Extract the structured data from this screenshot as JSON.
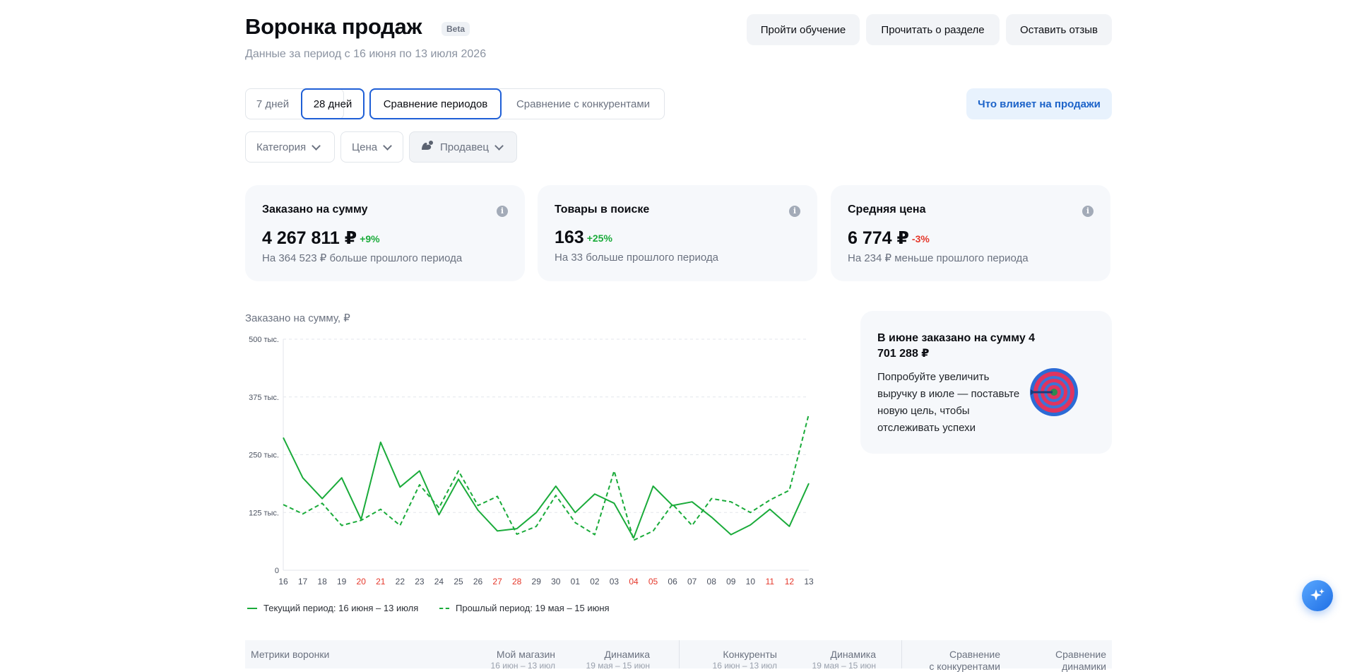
{
  "header": {
    "title": "Воронка продаж",
    "badge": "Beta",
    "period": "Данные за период с 16 июня по 13 июля 2026"
  },
  "top_buttons": {
    "training": "Пройти обучение",
    "read_about": "Прочитать о разделе",
    "feedback": "Оставить отзыв"
  },
  "periods": {
    "days7": "7 дней",
    "days28": "28 дней",
    "compare_periods": "Сравнение периодов",
    "compare_competitors": "Сравнение с конкурентами",
    "active": [
      "28 дней",
      "Сравнение периодов"
    ]
  },
  "what_affects": "Что влияет на продажи",
  "filters": {
    "category": "Категория",
    "price": "Цена",
    "seller": "Продавец"
  },
  "cards": [
    {
      "title": "Заказано на сумму",
      "value": "4 267 811 ₽",
      "change": "+9%",
      "change_color": "#1aab3a",
      "note": "На 364 523 ₽ больше прошлого периода"
    },
    {
      "title": "Товары в поиске",
      "value": "163",
      "change": "+25%",
      "change_color": "#1aab3a",
      "note": "На 33 больше прошлого периода"
    },
    {
      "title": "Средняя цена",
      "value": "6 774 ₽",
      "change": "-3%",
      "change_color": "#e5372a",
      "note": "На 234 ₽ меньше прошлого периода"
    }
  ],
  "chart": {
    "title": "Заказано на сумму, ₽",
    "legend_current": "Текущий период: 16 июня – 13 июля",
    "legend_previous": "Прошлый период: 19 мая – 15 июня"
  },
  "chart_data": {
    "type": "line",
    "ylabel": "Заказано на сумму, ₽",
    "ylim": [
      0,
      500000
    ],
    "yticks": [
      0,
      125000,
      250000,
      375000,
      500000
    ],
    "ytick_labels": [
      "0",
      "125 тыс.",
      "250 тыс.",
      "375 тыс.",
      "500 тыс."
    ],
    "categories": [
      "16",
      "17",
      "18",
      "19",
      "20",
      "21",
      "22",
      "23",
      "24",
      "25",
      "26",
      "27",
      "28",
      "29",
      "30",
      "01",
      "02",
      "03",
      "04",
      "05",
      "06",
      "07",
      "08",
      "09",
      "10",
      "11",
      "12",
      "13"
    ],
    "weekend_categories": [
      "20",
      "21",
      "27",
      "28",
      "04",
      "05",
      "11",
      "12"
    ],
    "weekend_color": "#e5372a",
    "grid": true,
    "legend_position": "bottom-left",
    "series": [
      {
        "name": "Текущий период: 16 июня – 13 июля",
        "style": "solid",
        "color": "#1aab3a",
        "values": [
          287000,
          200000,
          155000,
          200000,
          110000,
          277000,
          180000,
          215000,
          120000,
          197000,
          130000,
          85000,
          90000,
          125000,
          182000,
          125000,
          165000,
          145000,
          70000,
          182000,
          140000,
          148000,
          115000,
          77000,
          98000,
          132000,
          95000,
          188000
        ]
      },
      {
        "name": "Прошлый период: 19 мая – 15 июня",
        "style": "dashed",
        "color": "#1aab3a",
        "values": [
          142000,
          122000,
          145000,
          97000,
          108000,
          132000,
          97000,
          185000,
          135000,
          215000,
          140000,
          160000,
          78000,
          95000,
          162000,
          103000,
          77000,
          215000,
          65000,
          85000,
          143000,
          97000,
          155000,
          148000,
          125000,
          152000,
          173000,
          338000
        ]
      }
    ]
  },
  "goal_card": {
    "title": "В июне заказано на сумму 4 701 288 ₽",
    "text": "Попробуйте увеличить выручку в июле — поставьте новую цель, чтобы отслеживать успехи"
  },
  "table": {
    "metrics": "Метрики воронки",
    "my_store": "Мой магазин",
    "my_store_period": "16 июн – 13 июл",
    "dynamics": "Динамика",
    "dynamics_period": "19 мая – 15 июн",
    "competitors": "Конкуренты",
    "competitors_period": "16 июн – 13 июл",
    "dynamics2": "Динамика",
    "dynamics2_period": "19 мая – 15 июн",
    "compare_competitors_l1": "Сравнение",
    "compare_competitors_l2": "с конкурентами",
    "compare_dynamics_l1": "Сравнение",
    "compare_dynamics_l2": "динамики"
  }
}
